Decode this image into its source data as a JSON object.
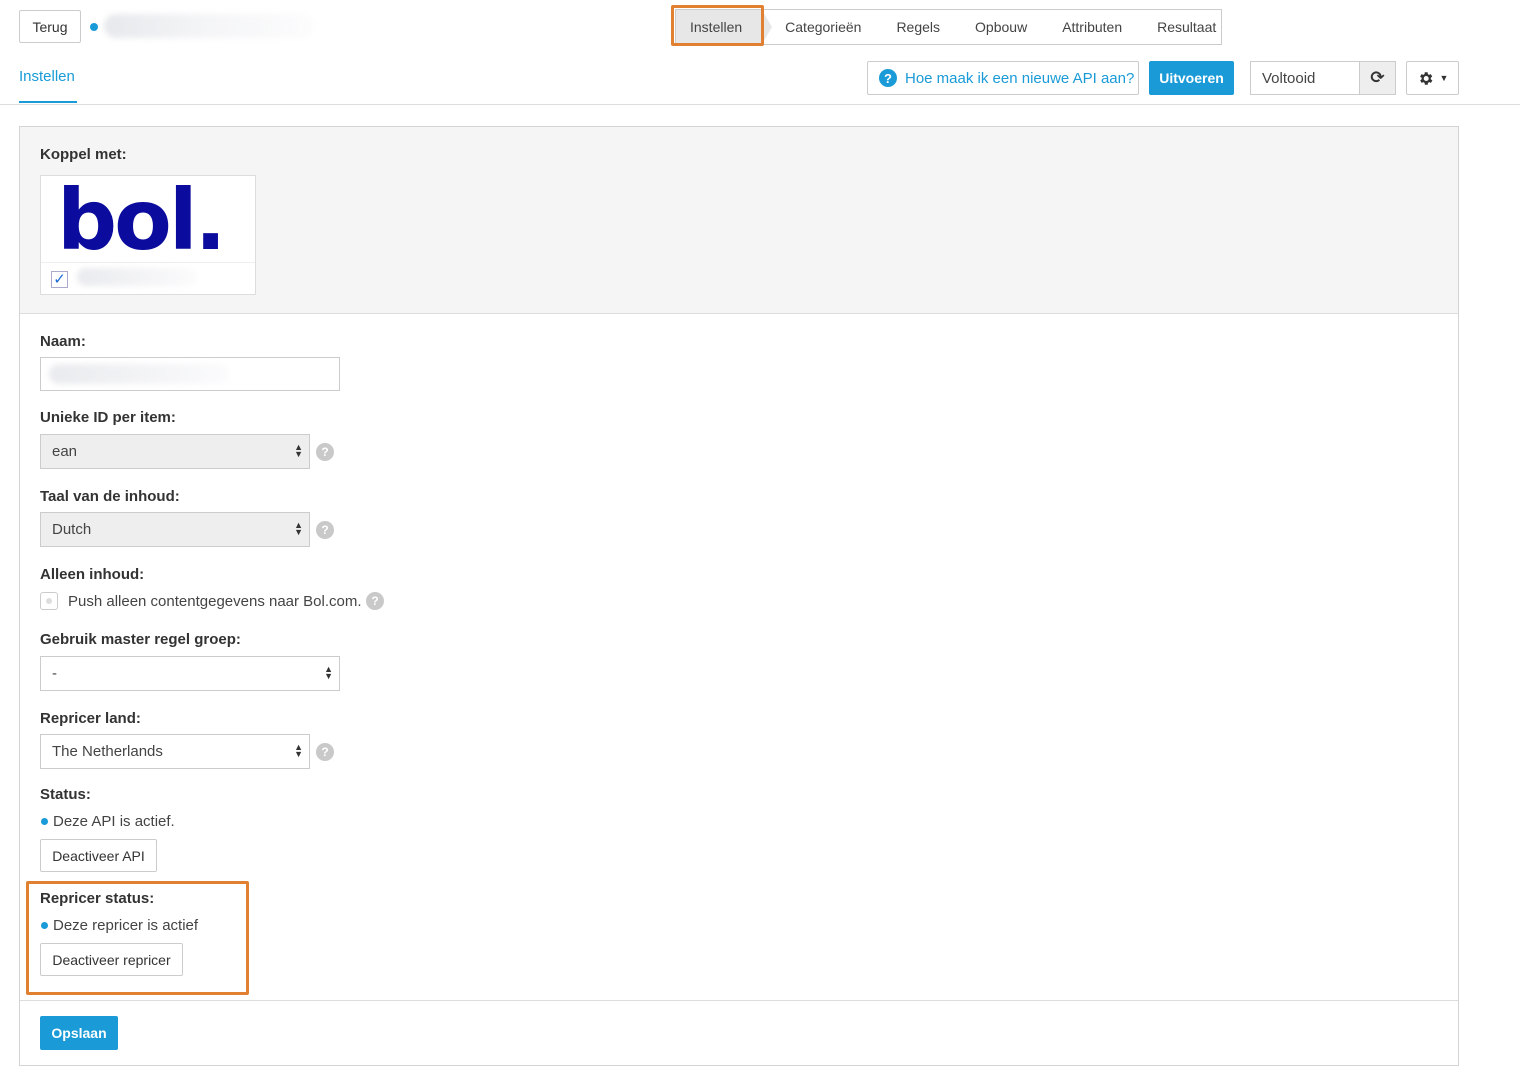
{
  "header": {
    "back_label": "Terug",
    "steps": [
      "Instellen",
      "Categorieën",
      "Regels",
      "Opbouw",
      "Attributen",
      "Resultaat"
    ],
    "active_step": "Instellen"
  },
  "subheader": {
    "page_tab": "Instellen",
    "help_label": "Hoe maak ik een nieuwe API aan?",
    "run_label": "Uitvoeren",
    "status_label": "Voltooid"
  },
  "form": {
    "koppel_label": "Koppel met:",
    "koppel_logo_text": "bol.",
    "name_label": "Naam:",
    "unique_id_label": "Unieke ID per item:",
    "unique_id_value": "ean",
    "language_label": "Taal van de inhoud:",
    "language_value": "Dutch",
    "content_only_label": "Alleen inhoud:",
    "content_only_text": "Push alleen contentgegevens naar Bol.com.",
    "master_rule_label": "Gebruik master regel groep:",
    "master_rule_value": "-",
    "repricer_country_label": "Repricer land:",
    "repricer_country_value": "The Netherlands",
    "status_label": "Status:",
    "status_text": "Deze API is actief.",
    "deactivate_api_label": "Deactiveer API",
    "repricer_status_label": "Repricer status:",
    "repricer_status_text": "Deze repricer is actief",
    "deactivate_repricer_label": "Deactiveer repricer",
    "save_label": "Opslaan"
  },
  "colors": {
    "accent": "#1a9bd7",
    "highlight": "#e08030",
    "brand_logo": "#0b0b9e"
  },
  "icons": {
    "help": "question-circle-icon",
    "refresh": "refresh-icon",
    "settings": "gear-icon",
    "select": "select-arrows-icon"
  }
}
